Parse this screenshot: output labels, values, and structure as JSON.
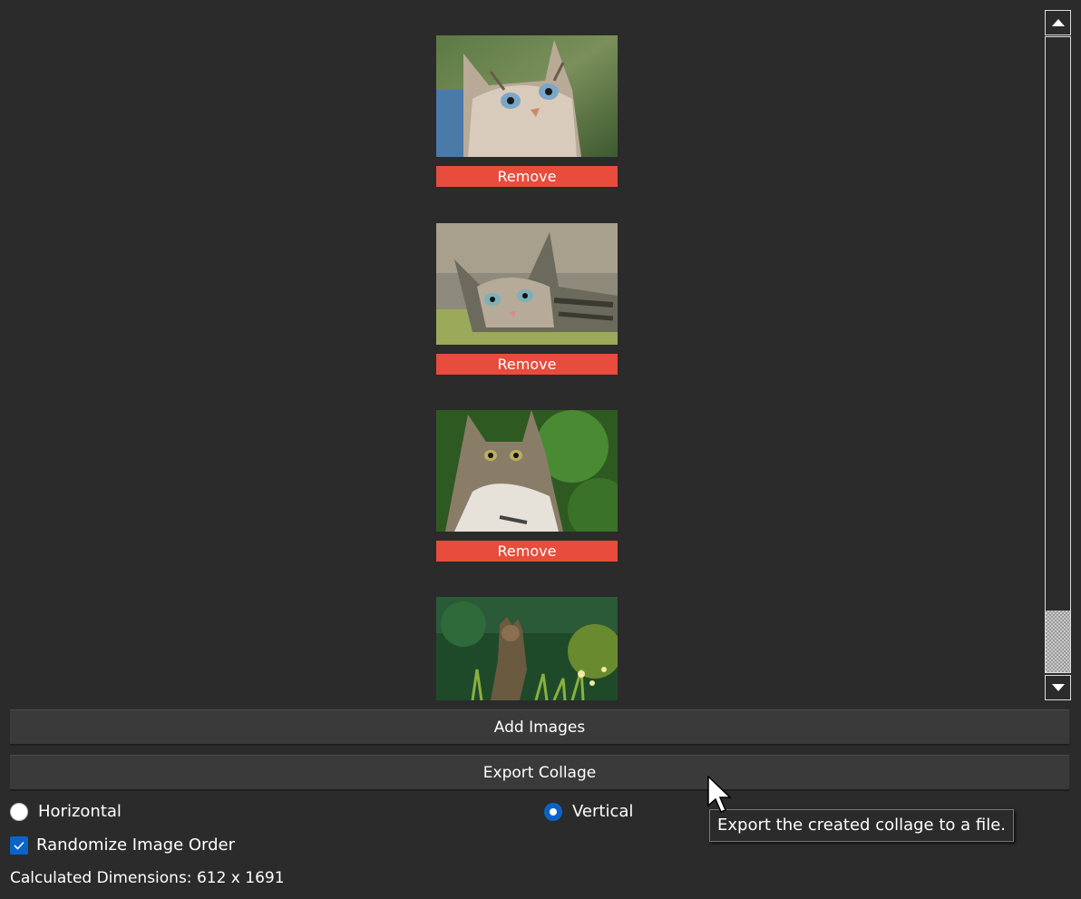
{
  "images": [
    {
      "remove_label": "Remove",
      "subject": "cat-photo-1"
    },
    {
      "remove_label": "Remove",
      "subject": "cat-photo-2"
    },
    {
      "remove_label": "Remove",
      "subject": "cat-photo-3"
    },
    {
      "remove_label": "",
      "subject": "cat-photo-4"
    }
  ],
  "buttons": {
    "add_images": "Add Images",
    "export_collage": "Export Collage"
  },
  "orientation": {
    "horizontal_label": "Horizontal",
    "vertical_label": "Vertical",
    "selected": "Vertical"
  },
  "randomize": {
    "label": "Randomize Image Order",
    "checked": true
  },
  "dimensions_text": "Calculated Dimensions: 612 x 1691",
  "tooltip": "Export the created collage to a file.",
  "colors": {
    "background": "#2b2b2b",
    "remove_button": "#e74c3c",
    "accent": "#0a64c8"
  }
}
